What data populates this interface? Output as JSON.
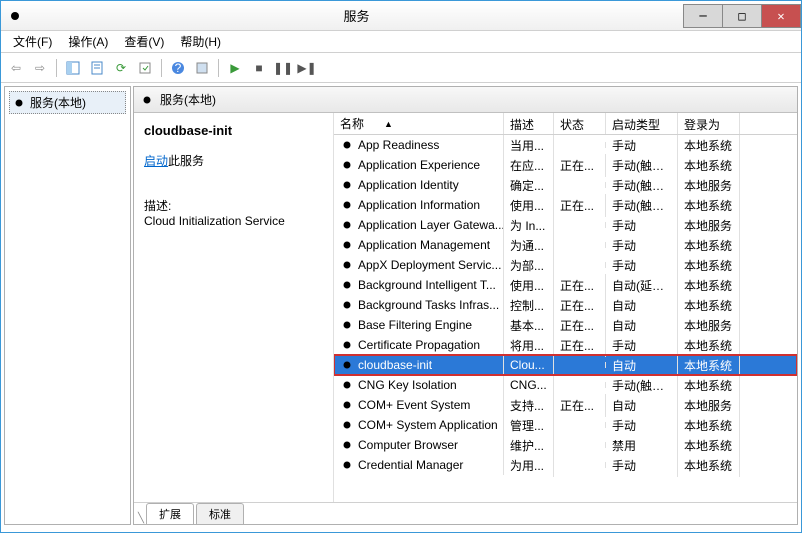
{
  "window": {
    "title": "服务"
  },
  "menubar": {
    "file": "文件(F)",
    "action": "操作(A)",
    "view": "查看(V)",
    "help": "帮助(H)"
  },
  "left_tree": {
    "root": "服务(本地)"
  },
  "panel": {
    "heading": "服务(本地)"
  },
  "detail": {
    "selected_name": "cloudbase-init",
    "start_link": "启动",
    "start_suffix": "此服务",
    "desc_label": "描述:",
    "desc_text": "Cloud Initialization Service"
  },
  "columns": {
    "name": "名称",
    "desc": "描述",
    "status": "状态",
    "startup": "启动类型",
    "logon": "登录为"
  },
  "services": [
    {
      "name": "App Readiness",
      "desc": "当用...",
      "status": "",
      "startup": "手动",
      "logon": "本地系统"
    },
    {
      "name": "Application Experience",
      "desc": "在应...",
      "status": "正在...",
      "startup": "手动(触发...",
      "logon": "本地系统"
    },
    {
      "name": "Application Identity",
      "desc": "确定...",
      "status": "",
      "startup": "手动(触发...",
      "logon": "本地服务"
    },
    {
      "name": "Application Information",
      "desc": "使用...",
      "status": "正在...",
      "startup": "手动(触发...",
      "logon": "本地系统"
    },
    {
      "name": "Application Layer Gatewa...",
      "desc": "为 In...",
      "status": "",
      "startup": "手动",
      "logon": "本地服务"
    },
    {
      "name": "Application Management",
      "desc": "为通...",
      "status": "",
      "startup": "手动",
      "logon": "本地系统"
    },
    {
      "name": "AppX Deployment Servic...",
      "desc": "为部...",
      "status": "",
      "startup": "手动",
      "logon": "本地系统"
    },
    {
      "name": "Background Intelligent T...",
      "desc": "使用...",
      "status": "正在...",
      "startup": "自动(延迟...",
      "logon": "本地系统"
    },
    {
      "name": "Background Tasks Infras...",
      "desc": "控制...",
      "status": "正在...",
      "startup": "自动",
      "logon": "本地系统"
    },
    {
      "name": "Base Filtering Engine",
      "desc": "基本...",
      "status": "正在...",
      "startup": "自动",
      "logon": "本地服务"
    },
    {
      "name": "Certificate Propagation",
      "desc": "将用...",
      "status": "正在...",
      "startup": "手动",
      "logon": "本地系统"
    },
    {
      "name": "cloudbase-init",
      "desc": "Clou...",
      "status": "",
      "startup": "自动",
      "logon": "本地系统",
      "selected": true
    },
    {
      "name": "CNG Key Isolation",
      "desc": "CNG...",
      "status": "",
      "startup": "手动(触发...",
      "logon": "本地系统"
    },
    {
      "name": "COM+ Event System",
      "desc": "支持...",
      "status": "正在...",
      "startup": "自动",
      "logon": "本地服务"
    },
    {
      "name": "COM+ System Application",
      "desc": "管理...",
      "status": "",
      "startup": "手动",
      "logon": "本地系统"
    },
    {
      "name": "Computer Browser",
      "desc": "维护...",
      "status": "",
      "startup": "禁用",
      "logon": "本地系统"
    },
    {
      "name": "Credential Manager",
      "desc": "为用...",
      "status": "",
      "startup": "手动",
      "logon": "本地系统"
    }
  ],
  "tabs": {
    "extended": "扩展",
    "standard": "标准"
  }
}
